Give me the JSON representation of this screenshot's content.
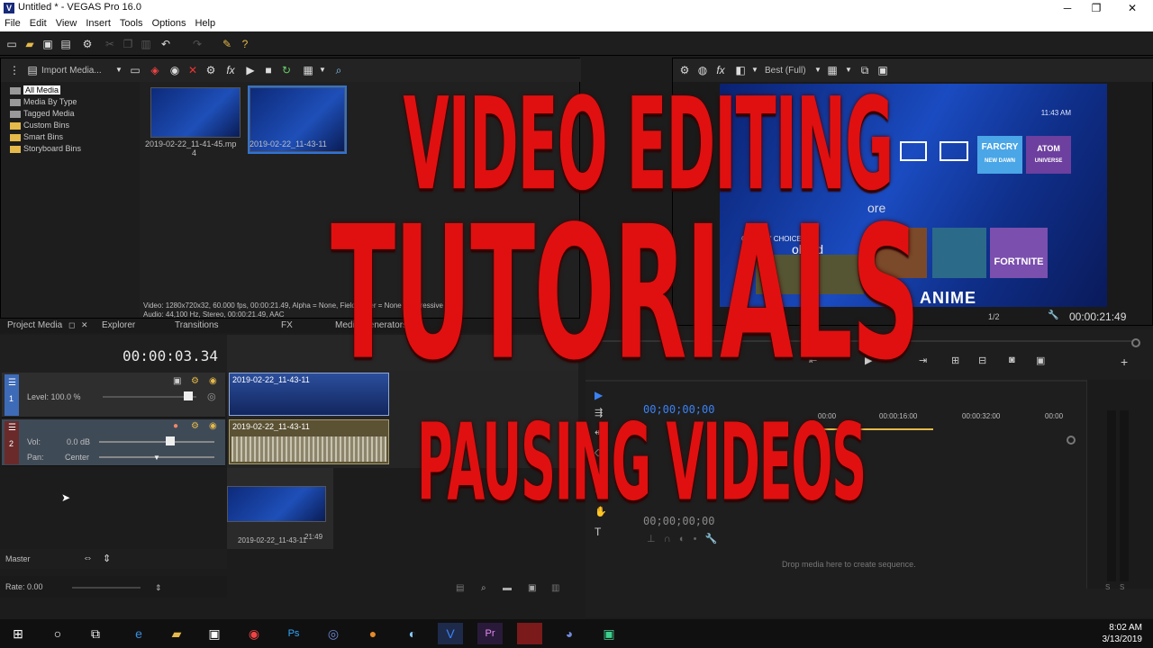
{
  "window": {
    "title": "Untitled * - VEGAS Pro 16.0",
    "minimize": "─",
    "maximize": "❐",
    "close": "✕"
  },
  "menu": [
    "File",
    "Edit",
    "View",
    "Insert",
    "Tools",
    "Options",
    "Help"
  ],
  "media_toolbar": {
    "import_label": "Import Media..."
  },
  "media_tree": [
    "All Media",
    "Media By Type",
    "Tagged Media",
    "Custom Bins",
    "Smart Bins",
    "Storyboard Bins"
  ],
  "media_files": [
    {
      "name": "2019-02-22_11-41-45.mp",
      "sub": "4"
    },
    {
      "name": "2019-02-22_11-43-11",
      "sub": ""
    }
  ],
  "media_info": {
    "line1": "Video: 1280x720x32, 60.000 fps, 00:00:21.49, Alpha = None, Field Order = None (progressive scan)",
    "line2": "Audio: 44,100 Hz, Stereo, 00:00:21.49, AAC"
  },
  "bottom_tabs": [
    "Project Media",
    "Explorer",
    "Transitions",
    "FX",
    "Media Generators"
  ],
  "timecode": "00:00:03.34",
  "track1": {
    "level": "Level: 100.0 %",
    "number": "1"
  },
  "track2": {
    "vol_label": "Vol:",
    "vol_value": "0.0 dB",
    "pan_label": "Pan:",
    "pan_value": "Center",
    "number": "2"
  },
  "clips": [
    "2019-02-22_11-43-11",
    "2019-02-22_11-43-11"
  ],
  "storyboard": {
    "clip_name": "2019-02-22_11-43-11",
    "duration": "21:49"
  },
  "master_label": "Master",
  "rate_label": "Rate: 0.00",
  "preview_toolbar": {
    "quality": "Best (Full)"
  },
  "preview_screen": {
    "time": "11:43 AM",
    "critics": "CRITICS' CHOICE",
    "fortnite": "FORTNITE",
    "farcry": "FARCRY",
    "farcry_sub": "NEW DAWN",
    "atom": "ATOM",
    "atom_sub": "UNIVERSE",
    "anime": "ANIME",
    "more": "ore",
    "john": "ohn d"
  },
  "preview_footer": {
    "ratio": "1/2",
    "timecode": "00:00:21:49"
  },
  "trimmer": {
    "timecode": "00;00;00;00",
    "ruler": [
      "00:00",
      "00:00:16:00",
      "00:00:32:00",
      "00:00"
    ],
    "timecode2": "00;00;00;00",
    "drop_hint": "Drop media here to create sequence."
  },
  "overlay": {
    "line1": "VIDEO EDITING",
    "line2": "TUTORIALS",
    "line3": "PAUSING VIDEOS"
  },
  "taskbar": {
    "time": "8:02 AM",
    "date": "3/13/2019"
  },
  "colors": {
    "overlay_red": "#e01010",
    "accent_blue": "#2e73d6"
  }
}
